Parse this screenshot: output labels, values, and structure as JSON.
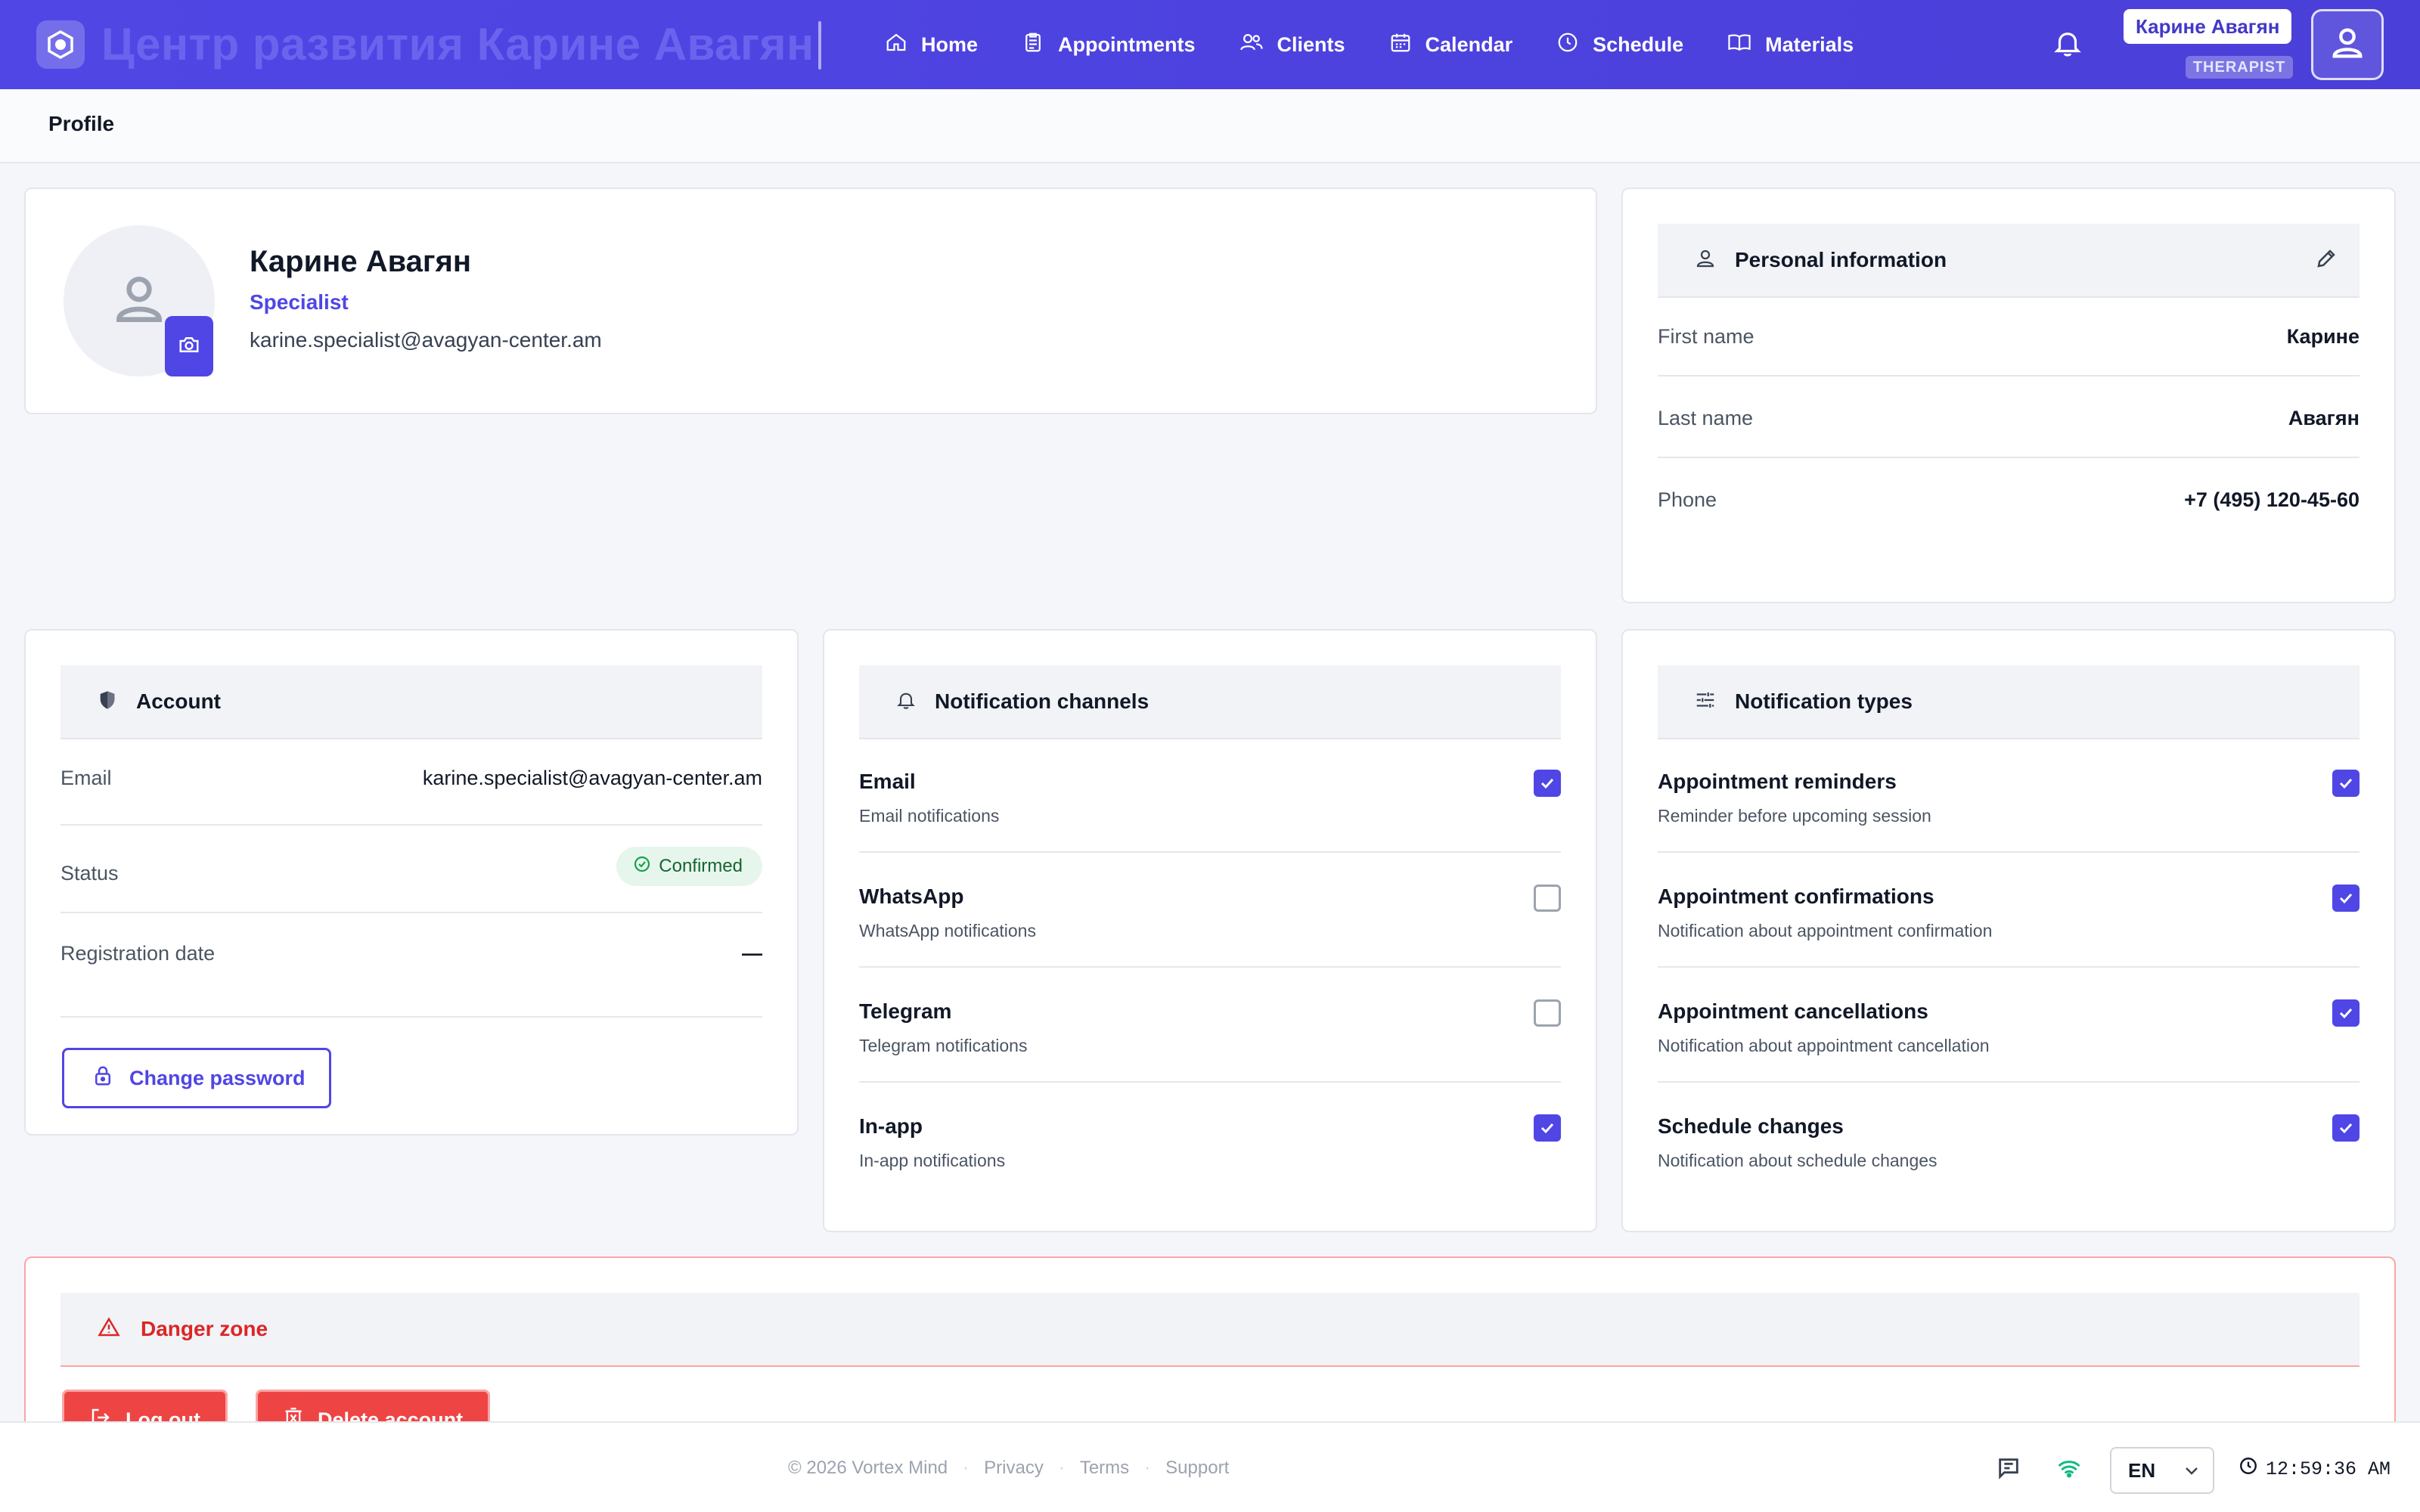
{
  "header": {
    "brand_title": "Центр развития Карине Авагян",
    "nav": [
      {
        "label": "Home",
        "icon": "home-icon"
      },
      {
        "label": "Appointments",
        "icon": "clipboard-icon"
      },
      {
        "label": "Clients",
        "icon": "users-icon"
      },
      {
        "label": "Calendar",
        "icon": "calendar-icon"
      },
      {
        "label": "Schedule",
        "icon": "clock-icon"
      },
      {
        "label": "Materials",
        "icon": "book-icon"
      }
    ],
    "user_name": "Карине Авагян",
    "user_role": "THERAPIST"
  },
  "page": {
    "title": "Profile"
  },
  "profile": {
    "name": "Карине Авагян",
    "role": "Specialist",
    "email": "karine.specialist@avagyan-center.am"
  },
  "personal": {
    "title": "Personal information",
    "rows": [
      {
        "label": "First name",
        "value": "Карине"
      },
      {
        "label": "Last name",
        "value": "Авагян"
      },
      {
        "label": "Phone",
        "value": "+7 (495) 120-45-60"
      }
    ]
  },
  "account": {
    "title": "Account",
    "email_label": "Email",
    "email_value": "karine.specialist@avagyan-center.am",
    "status_label": "Status",
    "status_value": "Confirmed",
    "reg_label": "Registration date",
    "reg_value": "—",
    "change_password": "Change password"
  },
  "channels": {
    "title": "Notification channels",
    "items": [
      {
        "title": "Email",
        "desc": "Email notifications",
        "checked": true
      },
      {
        "title": "WhatsApp",
        "desc": "WhatsApp notifications",
        "checked": false
      },
      {
        "title": "Telegram",
        "desc": "Telegram notifications",
        "checked": false
      },
      {
        "title": "In-app",
        "desc": "In-app notifications",
        "checked": true
      }
    ]
  },
  "types": {
    "title": "Notification types",
    "items": [
      {
        "title": "Appointment reminders",
        "desc": "Reminder before upcoming session",
        "checked": true
      },
      {
        "title": "Appointment confirmations",
        "desc": "Notification about appointment confirmation",
        "checked": true
      },
      {
        "title": "Appointment cancellations",
        "desc": "Notification about appointment cancellation",
        "checked": true
      },
      {
        "title": "Schedule changes",
        "desc": "Notification about schedule changes",
        "checked": true
      }
    ]
  },
  "danger": {
    "title": "Danger zone",
    "logout": "Log out",
    "delete": "Delete account"
  },
  "footer": {
    "copyright": "© 2026 Vortex Mind",
    "links": [
      "Privacy",
      "Terms",
      "Support"
    ],
    "language": "EN",
    "time": "12:59:36 AM"
  },
  "colors": {
    "primary": "#4f46e5",
    "danger": "#ef4444",
    "success": "#16a34a"
  }
}
